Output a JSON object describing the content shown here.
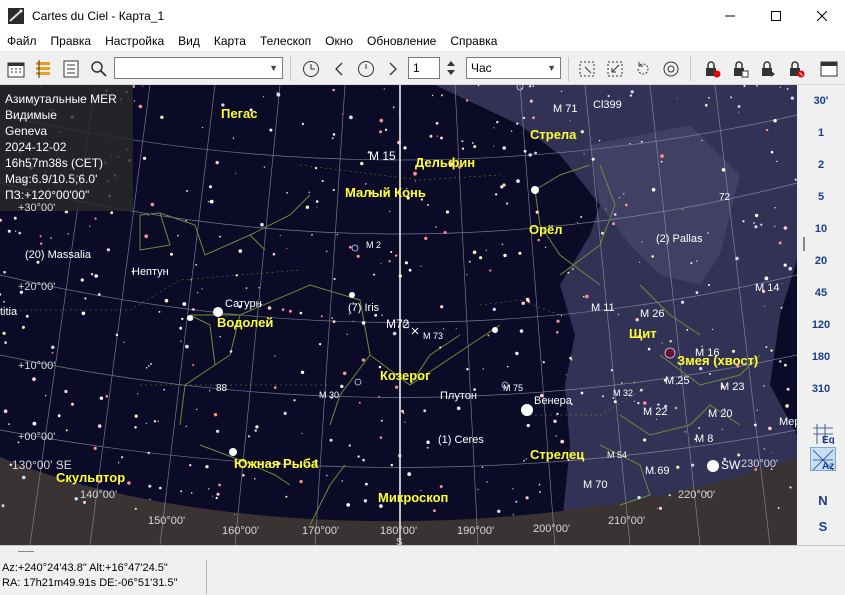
{
  "window": {
    "title": "Cartes du Ciel - Карта_1",
    "minimize": "—",
    "maximize": "☐",
    "close": "✕"
  },
  "menu": [
    "Файл",
    "Правка",
    "Настройка",
    "Вид",
    "Карта",
    "Телескоп",
    "Окно",
    "Обновление",
    "Справка"
  ],
  "toolbar": {
    "search_value": "",
    "step_value": "1",
    "unit_value": "Час"
  },
  "info": {
    "projection": "Азимутальные MER",
    "visibility": "Видимые",
    "location": "Geneva",
    "date": "2024-12-02",
    "time": "16h57m38s (CET)",
    "mag": "Mag:6.9/10.5,6.0'",
    "fov": "ПЗ:+120°00'00\""
  },
  "constellations": [
    {
      "id": "pegasus",
      "text": "Пегас"
    },
    {
      "id": "delphinus",
      "text": "Дельфин"
    },
    {
      "id": "sagitta",
      "text": "Стрела"
    },
    {
      "id": "equuleus",
      "text": "Малый Конь"
    },
    {
      "id": "aquila",
      "text": "Орёл"
    },
    {
      "id": "aquarius",
      "text": "Водолей"
    },
    {
      "id": "scutum",
      "text": "Щит"
    },
    {
      "id": "serpens",
      "text": "Змея (хвост)"
    },
    {
      "id": "capricornus",
      "text": "Козерог"
    },
    {
      "id": "sagittarius",
      "text": "Стрелец"
    },
    {
      "id": "piscis-austrinus",
      "text": "Южная Рыба"
    },
    {
      "id": "sculptor",
      "text": "Скульптор"
    },
    {
      "id": "microscopium",
      "text": "Микроскоп"
    }
  ],
  "objects": [
    {
      "id": "m15",
      "text": "M 15"
    },
    {
      "id": "m71",
      "text": "M 71"
    },
    {
      "id": "c399",
      "text": "Cl399"
    },
    {
      "id": "m2",
      "text": "M 2"
    },
    {
      "id": "massalia",
      "text": "(20) Massalia"
    },
    {
      "id": "neptune",
      "text": "Нептун"
    },
    {
      "id": "pallas",
      "text": "(2) Pallas"
    },
    {
      "id": "saturn",
      "text": "Сатурн"
    },
    {
      "id": "iris",
      "text": "(7) Iris"
    },
    {
      "id": "m72",
      "text": "M72"
    },
    {
      "id": "m73",
      "text": "M 73"
    },
    {
      "id": "m11",
      "text": "M 11"
    },
    {
      "id": "m26",
      "text": "M 26"
    },
    {
      "id": "m14",
      "text": "M 14"
    },
    {
      "id": "m16",
      "text": "M 16"
    },
    {
      "id": "m25",
      "text": "M 25"
    },
    {
      "id": "m23",
      "text": "M 23"
    },
    {
      "id": "m30",
      "text": "M 30"
    },
    {
      "id": "m75",
      "text": "M 75"
    },
    {
      "id": "pluto",
      "text": "Плутон"
    },
    {
      "id": "venus",
      "text": "Венера"
    },
    {
      "id": "m22",
      "text": "M 22"
    },
    {
      "id": "m20",
      "text": "M 20"
    },
    {
      "id": "m8",
      "text": "M 8"
    },
    {
      "id": "ceres",
      "text": "(1) Ceres"
    },
    {
      "id": "m54",
      "text": "M 54"
    },
    {
      "id": "m69",
      "text": "M 69"
    },
    {
      "id": "m70",
      "text": "M 70"
    },
    {
      "id": "sw",
      "text": "SW"
    },
    {
      "id": "mer",
      "text": "Мер"
    },
    {
      "id": "num88",
      "text": "88"
    },
    {
      "id": "num72",
      "text": "72"
    },
    {
      "id": "m32",
      "text": "M 32"
    },
    {
      "id": "titia",
      "text": "titia"
    }
  ],
  "grid_labels": [
    {
      "id": "dec30",
      "text": "+30°00'"
    },
    {
      "id": "dec20",
      "text": "+20°00'"
    },
    {
      "id": "dec10",
      "text": "+10°00'"
    },
    {
      "id": "dec0",
      "text": "+00°00'"
    },
    {
      "id": "az130se",
      "text": "130°00' SE"
    },
    {
      "id": "az140",
      "text": "140°00'"
    },
    {
      "id": "az150",
      "text": "150°00'"
    },
    {
      "id": "az160",
      "text": "160°00'"
    },
    {
      "id": "az170",
      "text": "170°00'"
    },
    {
      "id": "az180",
      "text": "180°00'"
    },
    {
      "id": "az190",
      "text": "190°00'"
    },
    {
      "id": "az200",
      "text": "200°00'"
    },
    {
      "id": "az210",
      "text": "210°00'"
    },
    {
      "id": "az220",
      "text": "220°00'"
    },
    {
      "id": "az230",
      "text": "230°00'"
    },
    {
      "id": "south",
      "text": "S"
    }
  ],
  "fov_scale": [
    "30'",
    "1",
    "2",
    "5",
    "10",
    "20",
    "45",
    "120",
    "180",
    "310"
  ],
  "side_buttons": {
    "eq": "Eq",
    "az": "Az",
    "north": "N",
    "south": "S"
  },
  "status": {
    "altaz": "Az:+240°24'43.8\" Alt:+16°47'24.5\"",
    "radec": "RA: 17h21m49.91s DE:-06°51'31.5\""
  }
}
